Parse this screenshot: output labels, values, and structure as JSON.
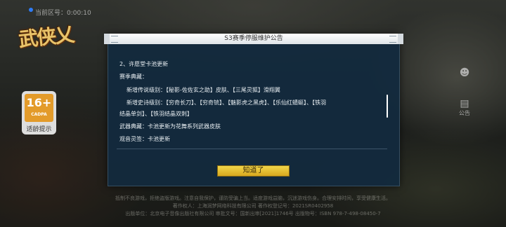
{
  "status": {
    "uid_text": "当前区号：0:00:10"
  },
  "logo": {
    "text": "武侠乂"
  },
  "age_rating": {
    "age": "16+",
    "org": "CADPA",
    "label": "适龄提示"
  },
  "side_icons": [
    {
      "icon": "person-icon",
      "label": ""
    },
    {
      "icon": "notice-icon",
      "label": "公告"
    }
  ],
  "modal": {
    "title": "S3赛季停服维护公告",
    "lines": [
      "2、许愿堂卡池更新",
      "赛季典藏：",
      "新增传说级别：【秘影-佐佐玄之助】皮肤、【三尾灵狐】滑翔翼",
      "新增史诗级别：【穷奇长刀】、【穷奇铳】、【魅影虎之黑虎】、【乐仙红蜻蜓】、【铁羽",
      "结晶单剑】、【铁羽结晶双刺】",
      "武器典藏：卡池更新为花舞系列武器皮肤",
      "观音灵签：卡池更新"
    ],
    "confirm_label": "知道了"
  },
  "footer": {
    "lines": [
      "抵制不良游戏，拒绝盗版游戏。注意自我保护，谨防受骗上当。适度游戏益脑，沉迷游戏伤身。合理安排时间，享受健康生活。",
      "著作权人：上海润梦网络科技有限公司  著作权登记号：2021SR0402958",
      "出版单位：北京电子音像出版社有限公司  审批文号：国新出审[2021]1746号  出版物号：ISBN 978-7-498-08450-7"
    ]
  }
}
